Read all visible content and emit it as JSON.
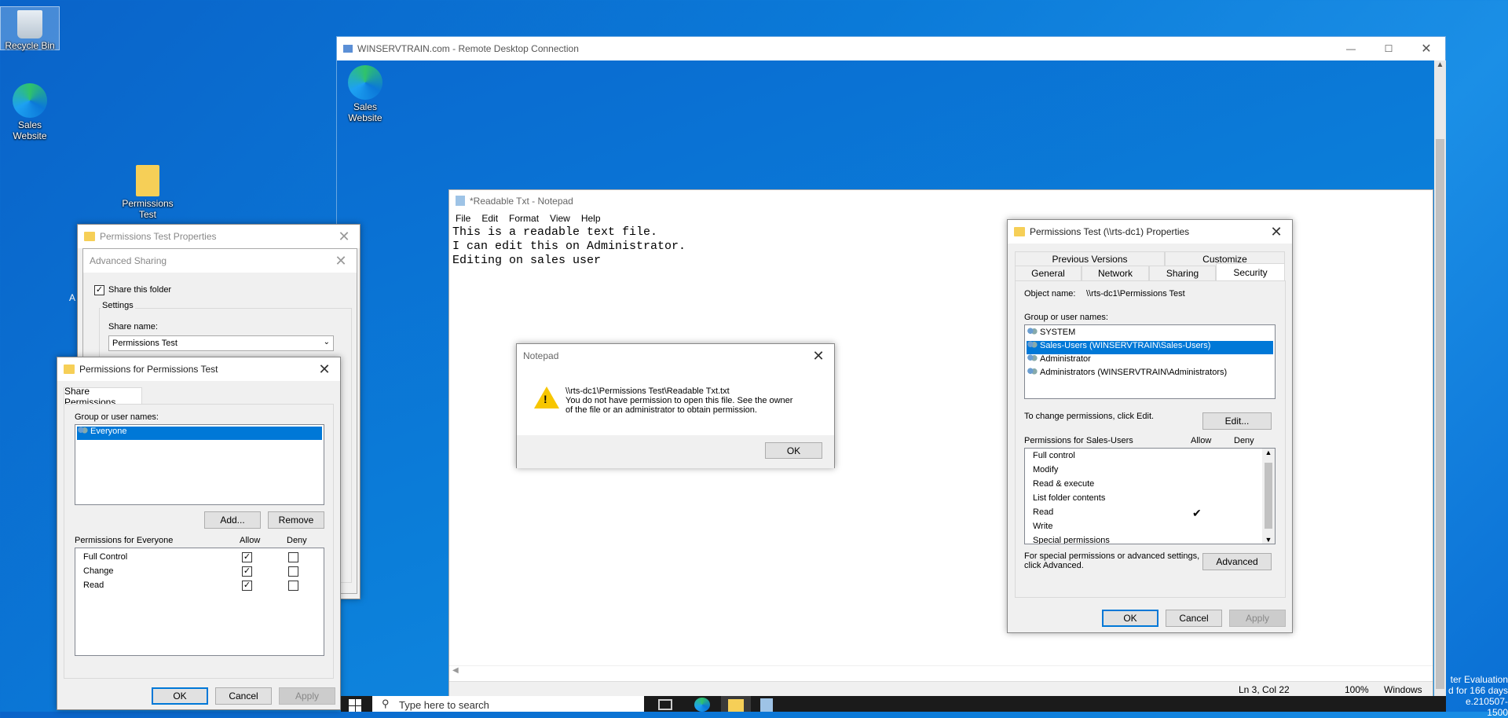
{
  "desktop": {
    "icons": [
      {
        "label": "Recycle Bin",
        "icon": "recycle-bin-icon"
      },
      {
        "label": "Sales Website",
        "icon": "edge-icon"
      },
      {
        "label": "Permissions Test",
        "icon": "folder-icon"
      }
    ],
    "partial_left_text": "A",
    "watermark": [
      "ter Evaluation",
      "d for 166 days",
      "e.210507-1500"
    ]
  },
  "rdp": {
    "title": "WINSERVTRAIN.com - Remote Desktop Connection",
    "icon_label": "Sales Website"
  },
  "notepad": {
    "title": "*Readable Txt - Notepad",
    "menu": [
      "File",
      "Edit",
      "Format",
      "View",
      "Help"
    ],
    "lines": [
      "This is a readable text file.",
      "I can edit this on Administrator.",
      "Editing on sales user"
    ],
    "status": {
      "pos": "Ln 3, Col 22",
      "zoom": "100%",
      "eol": "Windows (C"
    }
  },
  "error_dialog": {
    "title": "Notepad",
    "path": "\\\\rts-dc1\\Permissions Test\\Readable Txt.txt",
    "msg1": "You do not have permission to open this file.  See the owner",
    "msg2": "of the file or an administrator to obtain permission.",
    "ok": "OK"
  },
  "props_remote": {
    "title": "Permissions Test (\\\\rts-dc1) Properties",
    "tabs_top": [
      "Previous Versions",
      "Customize"
    ],
    "tabs_bottom": [
      "General",
      "Network",
      "Sharing",
      "Security"
    ],
    "object_label": "Object name:",
    "object_value": "\\\\rts-dc1\\Permissions Test",
    "group_label": "Group or user names:",
    "users": [
      "SYSTEM",
      "Sales-Users (WINSERVTRAIN\\Sales-Users)",
      "Administrator",
      "Administrators (WINSERVTRAIN\\Administrators)"
    ],
    "change_text": "To change permissions, click Edit.",
    "edit": "Edit...",
    "perm_label": "Permissions for Sales-Users",
    "allow": "Allow",
    "deny": "Deny",
    "perms": [
      "Full control",
      "Modify",
      "Read & execute",
      "List folder contents",
      "Read",
      "Write",
      "Special permissions"
    ],
    "check_mark": "✔",
    "special1": "For special permissions or advanced settings,",
    "special2": "click Advanced.",
    "advanced": "Advanced",
    "ok": "OK",
    "cancel": "Cancel",
    "apply": "Apply"
  },
  "props_local": {
    "title": "Permissions Test Properties"
  },
  "adv_sharing": {
    "title": "Advanced Sharing",
    "share_check": "Share this folder",
    "settings": "Settings",
    "share_name_label": "Share name:",
    "share_name": "Permissions Test"
  },
  "share_perm": {
    "title": "Permissions for Permissions Test",
    "tab": "Share Permissions",
    "group_label": "Group or user names:",
    "user": "Everyone",
    "add": "Add...",
    "remove": "Remove",
    "perm_label": "Permissions for Everyone",
    "allow": "Allow",
    "deny": "Deny",
    "perms": [
      "Full Control",
      "Change",
      "Read"
    ],
    "ok": "OK",
    "cancel": "Cancel",
    "apply": "Apply"
  },
  "taskbar": {
    "search_placeholder": "Type here to search"
  }
}
